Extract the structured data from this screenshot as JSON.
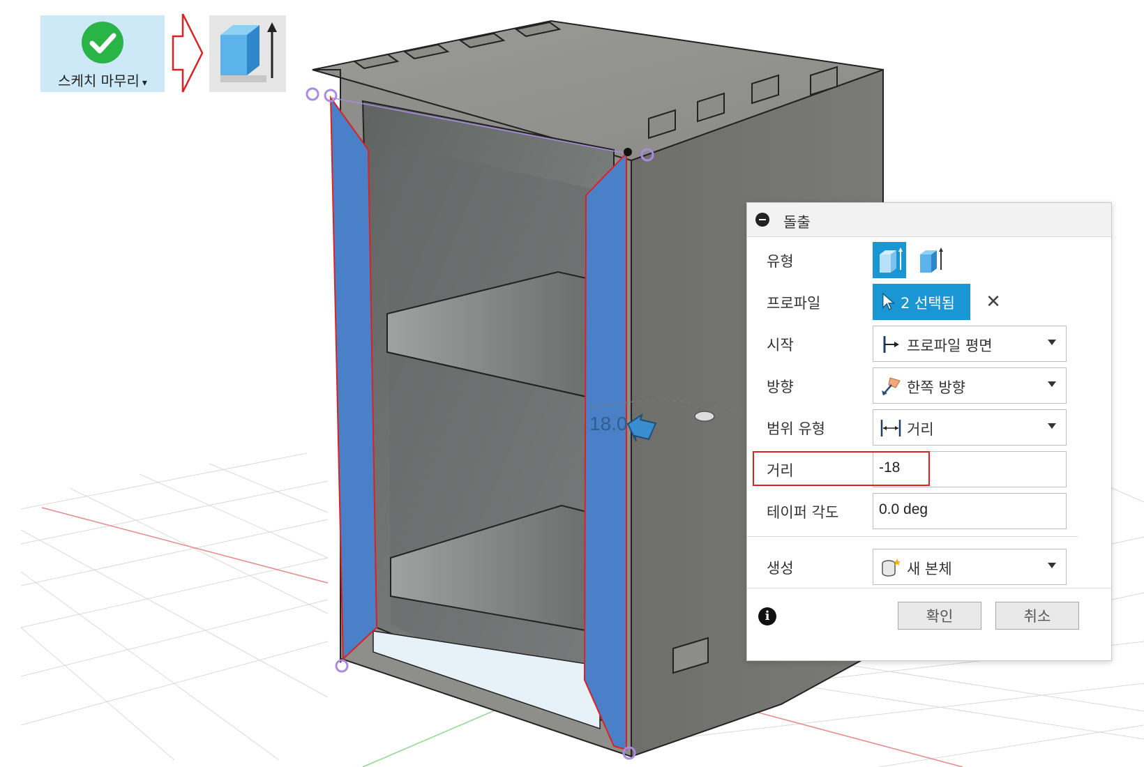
{
  "toolbar": {
    "finish_sketch_label": "스케치 마무리",
    "finish_sketch_caret": "▾"
  },
  "viewport": {
    "dimension_label": "18.0"
  },
  "dialog": {
    "title": "돌출",
    "type_label": "유형",
    "profile_label": "프로파일",
    "profile_selection": "2 선택됨",
    "start_label": "시작",
    "start_value": "프로파일 평면",
    "direction_label": "방향",
    "direction_value": "한쪽 방향",
    "extent_type_label": "범위 유형",
    "extent_type_value": "거리",
    "distance_label": "거리",
    "distance_value": "-18",
    "taper_label": "테이퍼 각도",
    "taper_value": "0.0 deg",
    "operation_label": "생성",
    "operation_value": "새 본체",
    "ok_label": "확인",
    "cancel_label": "취소",
    "clear_symbol": "✕",
    "info_symbol": "i"
  },
  "colors": {
    "accent": "#1a96d4",
    "highlight": "#e02020",
    "profile_face": "#4a80c8",
    "body": "#7c7c78"
  },
  "icons": [
    "check-circle-icon",
    "arrow-right-outline-icon",
    "extrude-icon",
    "thin-extrude-icon",
    "cursor-icon",
    "close-icon",
    "start-plane-icon",
    "direction-icon",
    "distance-icon",
    "new-body-icon",
    "info-icon",
    "dropdown-caret-icon"
  ]
}
